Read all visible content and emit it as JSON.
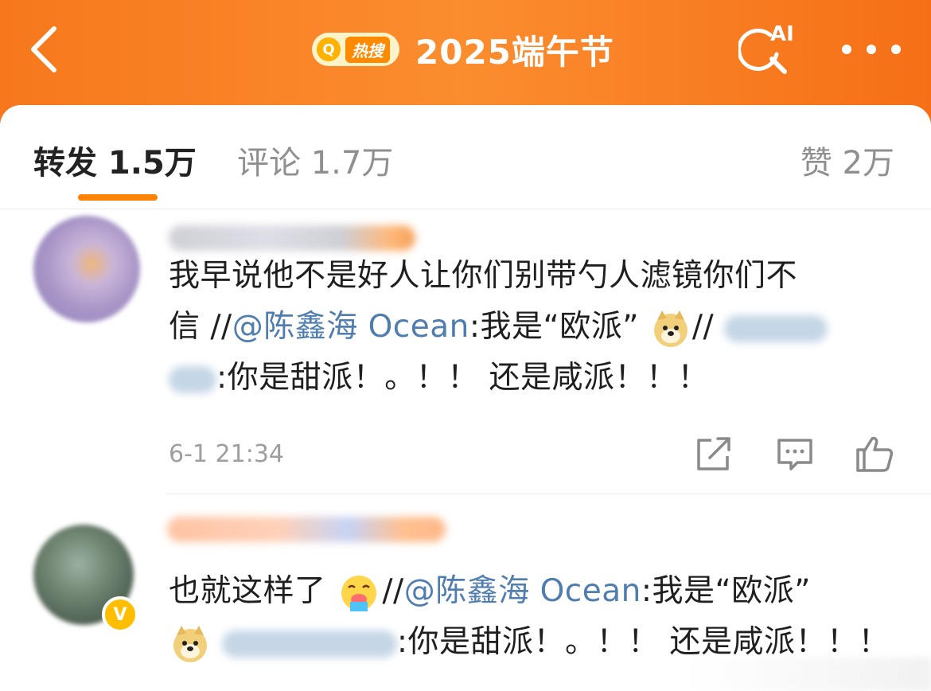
{
  "header": {
    "title": "2025端午节",
    "hot_badge": "热搜",
    "ai_label": "AI"
  },
  "tabs": {
    "repost": "转发 1.5万",
    "comment": "评论 1.7万",
    "like": "赞 2万"
  },
  "items": [
    {
      "line1": "我早说他不是好人让你们别带勺人滤镜你们不",
      "line2_prefix": "信 //",
      "mention": "@陈鑫海 Ocean",
      "line2_quote": ":我是“欧派”",
      "line2_sep": "//",
      "line3_text": ":你是甜派！。！！ 还是咸派！！！",
      "timestamp": "6-1 21:34"
    },
    {
      "line1_prefix": "也就这样了",
      "line1_sep": "//",
      "mention": "@陈鑫海 Ocean",
      "line1_quote": ":我是“欧派”",
      "line2_text": ":你是甜派！。！！ 还是咸派！！！"
    }
  ],
  "colors": {
    "header_orange": "#f7781c",
    "tab_indicator": "#ff8200",
    "mention_blue": "#507daf",
    "vip_badge": "#ffbf00"
  },
  "icons": [
    "back-arrow-icon",
    "search-icon",
    "ai-search-icon",
    "more-icon",
    "repost-icon",
    "comment-icon",
    "like-icon",
    "doge-emoji",
    "sweat-emoji",
    "verified-badge-icon"
  ]
}
